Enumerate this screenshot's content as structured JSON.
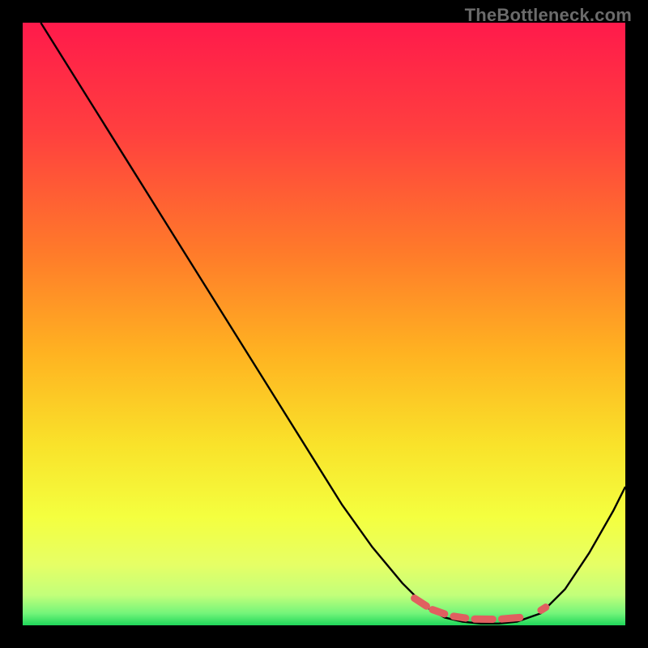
{
  "watermark": "TheBottleneck.com",
  "chart_data": {
    "type": "line",
    "title": "",
    "xlabel": "",
    "ylabel": "",
    "xlim": [
      0,
      100
    ],
    "ylim": [
      0,
      100
    ],
    "x": [
      3,
      8,
      13,
      18,
      23,
      28,
      33,
      38,
      43,
      48,
      53,
      58,
      63,
      67,
      70,
      73,
      76,
      79,
      82,
      86,
      90,
      94,
      98,
      100
    ],
    "values": [
      100,
      92,
      84,
      76,
      68,
      60,
      52,
      44,
      36,
      28,
      20,
      13,
      7,
      3,
      1.3,
      0.6,
      0.3,
      0.3,
      0.6,
      2,
      6,
      12,
      19,
      23
    ],
    "gradient_stops": [
      {
        "offset": 0,
        "color": "#ff1a4b"
      },
      {
        "offset": 18,
        "color": "#ff3f3f"
      },
      {
        "offset": 38,
        "color": "#ff7a2a"
      },
      {
        "offset": 55,
        "color": "#ffb321"
      },
      {
        "offset": 70,
        "color": "#f9e22a"
      },
      {
        "offset": 82,
        "color": "#f4ff3f"
      },
      {
        "offset": 90,
        "color": "#e6ff66"
      },
      {
        "offset": 95,
        "color": "#c2ff7a"
      },
      {
        "offset": 98,
        "color": "#74f57a"
      },
      {
        "offset": 100,
        "color": "#1fd65a"
      }
    ],
    "markers": {
      "color": "#e06060",
      "segments": [
        {
          "x0": 65,
          "y0": 4.5,
          "x1": 67,
          "y1": 3.2
        },
        {
          "x0": 68,
          "y0": 2.6,
          "x1": 70,
          "y1": 1.9
        },
        {
          "x0": 71.5,
          "y0": 1.5,
          "x1": 73.5,
          "y1": 1.2
        },
        {
          "x0": 75,
          "y0": 1.05,
          "x1": 78,
          "y1": 1.0
        },
        {
          "x0": 79.5,
          "y0": 1.05,
          "x1": 82.5,
          "y1": 1.3
        },
        {
          "x0": 86,
          "y0": 2.5,
          "x1": 86.8,
          "y1": 3.0
        }
      ]
    }
  }
}
